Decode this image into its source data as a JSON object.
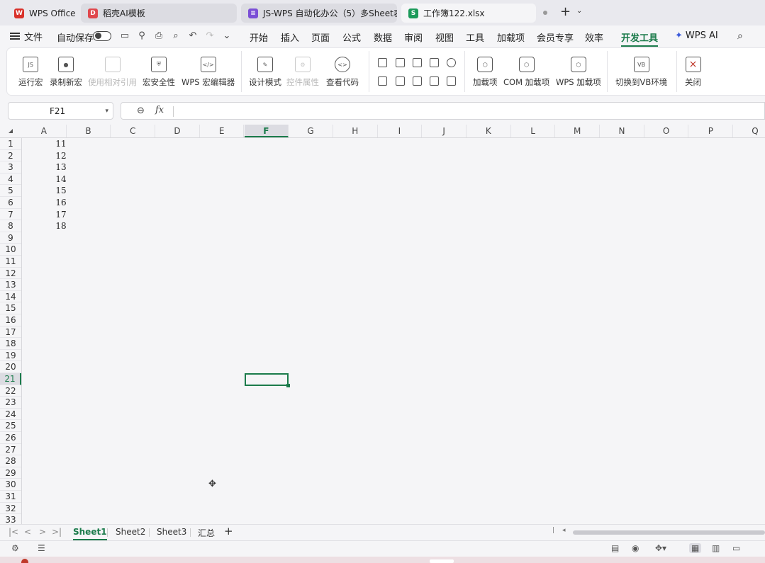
{
  "tabs": [
    {
      "label": "WPS Office",
      "icon": "wps-logo-icon",
      "color": "#d9322b"
    },
    {
      "label": "稻壳AI模板",
      "icon": "docer-logo-icon",
      "color": "#e0474c"
    },
    {
      "label": "JS-WPS 自动化办公（5）多Sheet表",
      "icon": "doc-purple-icon",
      "color": "#7b4fd6"
    },
    {
      "label": "工作簿122.xlsx",
      "icon": "sheet-green-icon",
      "color": "#1b9a5a"
    }
  ],
  "menu": {
    "file": "文件",
    "autosave": "自动保存",
    "items": [
      "开始",
      "插入",
      "页面",
      "公式",
      "数据",
      "审阅",
      "视图",
      "工具",
      "加载项",
      "会员专享",
      "效率",
      "开发工具",
      "WPS AI"
    ],
    "active": "开发工具"
  },
  "ribbon": {
    "run_macro": "运行宏",
    "record_macro": "录制新宏",
    "relative_ref": "使用相对引用",
    "macro_security": "宏安全性",
    "macro_editor": "WPS 宏编辑器",
    "design_mode": "设计模式",
    "control_props": "控件属性",
    "view_code": "查看代码",
    "addins": "加载项",
    "com_addins": "COM 加载项",
    "wps_addins": "WPS 加载项",
    "vb_env": "切换到VB环境",
    "close": "关闭"
  },
  "formula_bar": {
    "name_box": "F21",
    "fx": "fx",
    "value": ""
  },
  "columns": [
    "A",
    "B",
    "C",
    "D",
    "E",
    "F",
    "G",
    "H",
    "I",
    "J",
    "K",
    "L",
    "M",
    "N",
    "O",
    "P",
    "Q"
  ],
  "selected_column": "F",
  "rows": [
    "1",
    "2",
    "3",
    "4",
    "5",
    "6",
    "7",
    "8",
    "9",
    "10",
    "11",
    "12",
    "13",
    "14",
    "15",
    "16",
    "17",
    "18",
    "19",
    "20",
    "21",
    "22",
    "23",
    "24",
    "25",
    "26",
    "27",
    "28",
    "29",
    "30",
    "31",
    "32",
    "33"
  ],
  "selected_row": "21",
  "cells": {
    "A1": "11",
    "A2": "12",
    "A3": "13",
    "A4": "14",
    "A5": "15",
    "A6": "16",
    "A7": "17",
    "A8": "18"
  },
  "sheets": [
    {
      "label": "Sheet1",
      "active": true
    },
    {
      "label": "Sheet2",
      "active": false
    },
    {
      "label": "Sheet3",
      "active": false
    },
    {
      "label": "汇总",
      "active": false
    }
  ],
  "colors": {
    "accent": "#1b7b4b",
    "background": "#f5f5f7"
  }
}
